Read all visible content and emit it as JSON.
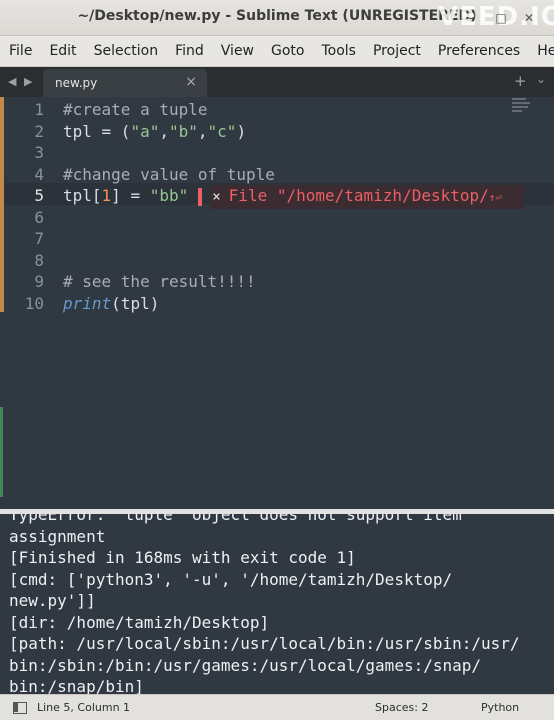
{
  "window": {
    "title": "~/Desktop/new.py - Sublime Text (UNREGISTERED)",
    "watermark": "VEED.IO",
    "controls": {
      "minimize": "–",
      "maximize": "□",
      "close": "✕"
    }
  },
  "menu": [
    "File",
    "Edit",
    "Selection",
    "Find",
    "View",
    "Goto",
    "Tools",
    "Project",
    "Preferences",
    "Help"
  ],
  "tabs": {
    "nav": "◀ ▶",
    "active": {
      "label": "new.py",
      "close": "×"
    },
    "new_tab": "+",
    "overflow": "⌄"
  },
  "editor": {
    "line_numbers": [
      "1",
      "2",
      "3",
      "4",
      "5",
      "6",
      "7",
      "8",
      "9",
      "10"
    ],
    "active_line": 5,
    "lines": {
      "l1": "#create a tuple",
      "l2_var": "tpl",
      "l2_eq": " = (",
      "l2_s1": "\"a\"",
      "l2_s2": "\"b\"",
      "l2_s3": "\"c\"",
      "l2_end": ")",
      "l4": "#change value of tuple",
      "l5_var": "tpl[",
      "l5_num": "1",
      "l5_mid": "] = ",
      "l5_str": "\"bb\"",
      "l9": "# see the result!!!!",
      "l10_fn": "print",
      "l10_args": "(tpl)"
    },
    "error_phantom": {
      "close": "×",
      "text": "File \"/home/tamizh/Desktop/",
      "tail": "↑⏎"
    }
  },
  "output": {
    "text": "TypeError: 'tuple' object does not support item\nassignment\n[Finished in 168ms with exit code 1]\n[cmd: ['python3', '-u', '/home/tamizh/Desktop/\nnew.py']]\n[dir: /home/tamizh/Desktop]\n[path: /usr/local/sbin:/usr/local/bin:/usr/sbin:/usr/\nbin:/sbin:/bin:/usr/games:/usr/local/games:/snap/\nbin:/snap/bin]"
  },
  "status": {
    "position": "Line 5, Column 1",
    "spaces": "Spaces: 2",
    "syntax": "Python"
  }
}
